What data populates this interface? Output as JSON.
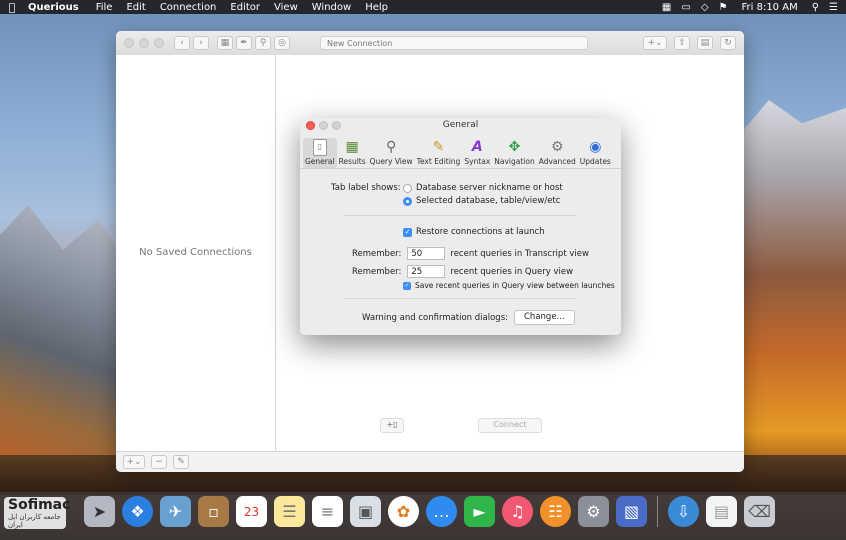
{
  "menubar": {
    "app": "Querious",
    "items": [
      "File",
      "Edit",
      "Connection",
      "Editor",
      "View",
      "Window",
      "Help"
    ],
    "clock": "Fri 8:10 AM"
  },
  "window": {
    "address": "New Connection",
    "sidebar_empty": "No Saved Connections",
    "connect_label": "Connect"
  },
  "prefs": {
    "title": "General",
    "tabs": [
      "General",
      "Results",
      "Query View",
      "Text Editing",
      "Syntax",
      "Navigation",
      "Advanced",
      "Updates"
    ],
    "tab_label_shows": "Tab label shows:",
    "option1": "Database server nickname or host",
    "option2": "Selected database, table/view/etc",
    "restore": "Restore connections at launch",
    "remember_label": "Remember:",
    "transcript_value": "50",
    "transcript_text": "recent queries in Transcript view",
    "query_value": "25",
    "query_text": "recent queries in Query view",
    "save_recent": "Save recent queries in Query view between launches",
    "warning_label": "Warning and confirmation dialogs:",
    "change_button": "Change..."
  },
  "watermark": {
    "line1": "Sofimac",
    "line2": "جامعه کاربران اپل ایران"
  },
  "colors": {
    "accent": "#3b8ff5",
    "close": "#fd5b55"
  }
}
